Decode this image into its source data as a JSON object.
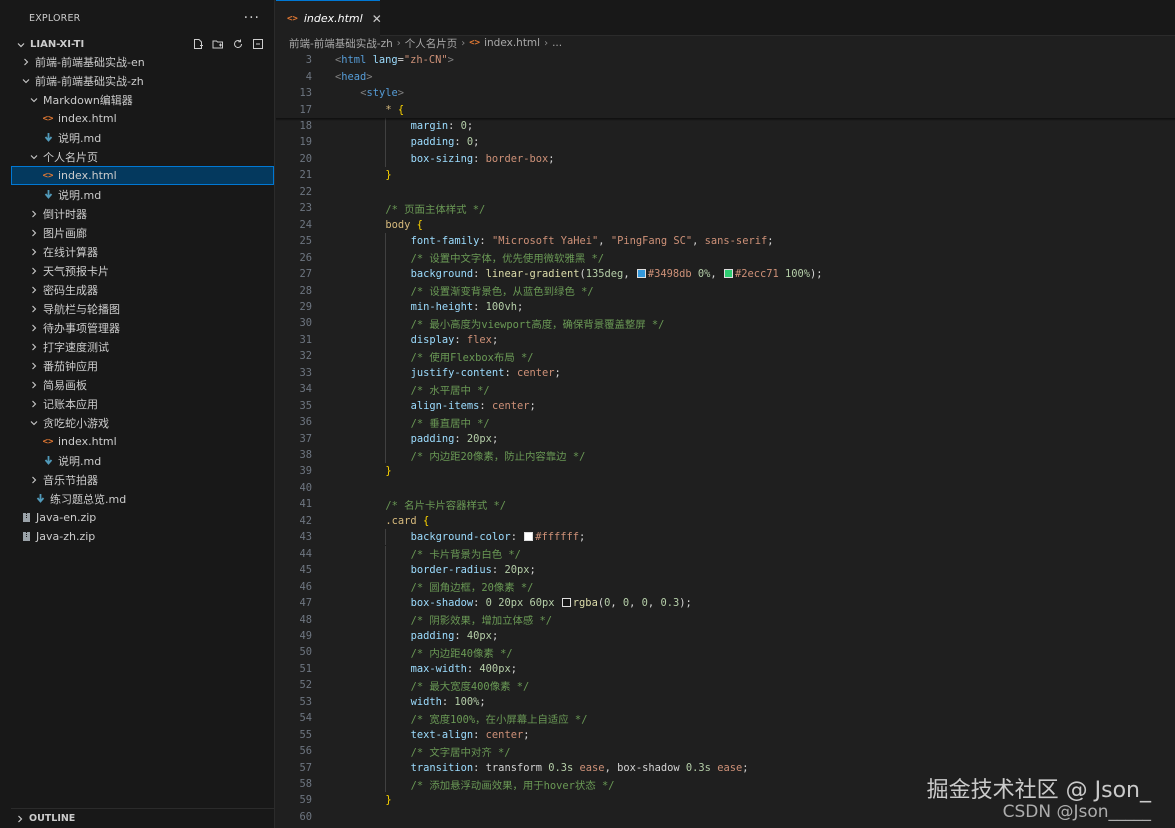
{
  "sidebar": {
    "title": "EXPLORER",
    "more": "···",
    "folder": "LIAN-XI-TI",
    "items": [
      {
        "label": "前端-前端基础实战-en",
        "type": "folder",
        "expanded": false,
        "depth": 1
      },
      {
        "label": "前端-前端基础实战-zh",
        "type": "folder",
        "expanded": true,
        "depth": 1
      },
      {
        "label": "Markdown编辑器",
        "type": "folder",
        "expanded": true,
        "depth": 2
      },
      {
        "label": "index.html",
        "type": "html",
        "depth": 3
      },
      {
        "label": "说明.md",
        "type": "md",
        "depth": 3
      },
      {
        "label": "个人名片页",
        "type": "folder",
        "expanded": true,
        "depth": 2
      },
      {
        "label": "index.html",
        "type": "html",
        "depth": 3,
        "selected": true
      },
      {
        "label": "说明.md",
        "type": "md",
        "depth": 3
      },
      {
        "label": "倒计时器",
        "type": "folder",
        "expanded": false,
        "depth": 2
      },
      {
        "label": "图片画廊",
        "type": "folder",
        "expanded": false,
        "depth": 2
      },
      {
        "label": "在线计算器",
        "type": "folder",
        "expanded": false,
        "depth": 2
      },
      {
        "label": "天气预报卡片",
        "type": "folder",
        "expanded": false,
        "depth": 2
      },
      {
        "label": "密码生成器",
        "type": "folder",
        "expanded": false,
        "depth": 2
      },
      {
        "label": "导航栏与轮播图",
        "type": "folder",
        "expanded": false,
        "depth": 2
      },
      {
        "label": "待办事项管理器",
        "type": "folder",
        "expanded": false,
        "depth": 2
      },
      {
        "label": "打字速度测试",
        "type": "folder",
        "expanded": false,
        "depth": 2
      },
      {
        "label": "番茄钟应用",
        "type": "folder",
        "expanded": false,
        "depth": 2
      },
      {
        "label": "简易画板",
        "type": "folder",
        "expanded": false,
        "depth": 2
      },
      {
        "label": "记账本应用",
        "type": "folder",
        "expanded": false,
        "depth": 2
      },
      {
        "label": "贪吃蛇小游戏",
        "type": "folder",
        "expanded": true,
        "depth": 2
      },
      {
        "label": "index.html",
        "type": "html",
        "depth": 3
      },
      {
        "label": "说明.md",
        "type": "md",
        "depth": 3
      },
      {
        "label": "音乐节拍器",
        "type": "folder",
        "expanded": false,
        "depth": 2
      },
      {
        "label": "练习题总览.md",
        "type": "md",
        "depth": 2
      },
      {
        "label": "Java-en.zip",
        "type": "zip",
        "depth": 1
      },
      {
        "label": "Java-zh.zip",
        "type": "zip",
        "depth": 1
      }
    ],
    "outline": "OUTLINE"
  },
  "editor": {
    "tab_label": "index.html",
    "breadcrumb": [
      "前端-前端基础实战-zh",
      "个人名片页",
      "index.html",
      "..."
    ]
  },
  "code_lines": [
    {
      "n": "3",
      "indent": 0,
      "sticky": true,
      "t": [
        [
          "tk-ang",
          "<"
        ],
        [
          "tk-tag",
          "html"
        ],
        [
          "tk-p",
          " "
        ],
        [
          "tk-attr",
          "lang"
        ],
        [
          "tk-eq",
          "="
        ],
        [
          "tk-str",
          "\"zh-CN\""
        ],
        [
          "tk-ang",
          ">"
        ]
      ]
    },
    {
      "n": "4",
      "indent": 0,
      "sticky": true,
      "t": [
        [
          "tk-ang",
          "<"
        ],
        [
          "tk-tag",
          "head"
        ],
        [
          "tk-ang",
          ">"
        ]
      ]
    },
    {
      "n": "13",
      "indent": 4,
      "sticky": true,
      "t": [
        [
          "tk-ang",
          "<"
        ],
        [
          "tk-tag",
          "style"
        ],
        [
          "tk-ang",
          ">"
        ]
      ]
    },
    {
      "n": "17",
      "indent": 8,
      "sticky": true,
      "t": [
        [
          "tk-sel",
          "* "
        ],
        [
          "tk-brace",
          "{"
        ]
      ]
    },
    {
      "n": "18",
      "indent": 12,
      "t": [
        [
          "tk-prop",
          "margin"
        ],
        [
          "tk-p",
          ": "
        ],
        [
          "tk-num",
          "0"
        ],
        [
          "tk-p",
          ";"
        ]
      ]
    },
    {
      "n": "19",
      "indent": 12,
      "t": [
        [
          "tk-prop",
          "padding"
        ],
        [
          "tk-p",
          ": "
        ],
        [
          "tk-num",
          "0"
        ],
        [
          "tk-p",
          ";"
        ]
      ]
    },
    {
      "n": "20",
      "indent": 12,
      "t": [
        [
          "tk-prop",
          "box-sizing"
        ],
        [
          "tk-p",
          ": "
        ],
        [
          "tk-val",
          "border-box"
        ],
        [
          "tk-p",
          ";"
        ]
      ]
    },
    {
      "n": "21",
      "indent": 8,
      "t": [
        [
          "tk-brace",
          "}"
        ]
      ]
    },
    {
      "n": "22",
      "indent": 0,
      "t": []
    },
    {
      "n": "23",
      "indent": 8,
      "t": [
        [
          "tk-com",
          "/* 页面主体样式 */"
        ]
      ]
    },
    {
      "n": "24",
      "indent": 8,
      "t": [
        [
          "tk-sel",
          "body "
        ],
        [
          "tk-brace",
          "{"
        ]
      ]
    },
    {
      "n": "25",
      "indent": 12,
      "t": [
        [
          "tk-prop",
          "font-family"
        ],
        [
          "tk-p",
          ": "
        ],
        [
          "tk-str",
          "\"Microsoft YaHei\""
        ],
        [
          "tk-p",
          ", "
        ],
        [
          "tk-str",
          "\"PingFang SC\""
        ],
        [
          "tk-p",
          ", "
        ],
        [
          "tk-val",
          "sans-serif"
        ],
        [
          "tk-p",
          ";"
        ]
      ]
    },
    {
      "n": "26",
      "indent": 12,
      "t": [
        [
          "tk-com",
          "/* 设置中文字体，优先使用微软雅黑 */"
        ]
      ]
    },
    {
      "n": "27",
      "indent": 12,
      "t": [
        [
          "tk-prop",
          "background"
        ],
        [
          "tk-p",
          ": "
        ],
        [
          "tk-fn",
          "linear-gradient"
        ],
        [
          "tk-p",
          "("
        ],
        [
          "tk-num",
          "135deg"
        ],
        [
          "tk-p",
          ", "
        ],
        [
          "swatch",
          "#3498db"
        ],
        [
          "tk-val",
          "#3498db"
        ],
        [
          "tk-p",
          " "
        ],
        [
          "tk-num",
          "0%"
        ],
        [
          "tk-p",
          ", "
        ],
        [
          "swatch",
          "#2ecc71"
        ],
        [
          "tk-val",
          "#2ecc71"
        ],
        [
          "tk-p",
          " "
        ],
        [
          "tk-num",
          "100%"
        ],
        [
          "tk-p",
          ");"
        ]
      ]
    },
    {
      "n": "28",
      "indent": 12,
      "t": [
        [
          "tk-com",
          "/* 设置渐变背景色，从蓝色到绿色 */"
        ]
      ]
    },
    {
      "n": "29",
      "indent": 12,
      "t": [
        [
          "tk-prop",
          "min-height"
        ],
        [
          "tk-p",
          ": "
        ],
        [
          "tk-num",
          "100vh"
        ],
        [
          "tk-p",
          ";"
        ]
      ]
    },
    {
      "n": "30",
      "indent": 12,
      "t": [
        [
          "tk-com",
          "/* 最小高度为viewport高度，确保背景覆盖整屏 */"
        ]
      ]
    },
    {
      "n": "31",
      "indent": 12,
      "t": [
        [
          "tk-prop",
          "display"
        ],
        [
          "tk-p",
          ": "
        ],
        [
          "tk-val",
          "flex"
        ],
        [
          "tk-p",
          ";"
        ]
      ]
    },
    {
      "n": "32",
      "indent": 12,
      "t": [
        [
          "tk-com",
          "/* 使用Flexbox布局 */"
        ]
      ]
    },
    {
      "n": "33",
      "indent": 12,
      "t": [
        [
          "tk-prop",
          "justify-content"
        ],
        [
          "tk-p",
          ": "
        ],
        [
          "tk-val",
          "center"
        ],
        [
          "tk-p",
          ";"
        ]
      ]
    },
    {
      "n": "34",
      "indent": 12,
      "t": [
        [
          "tk-com",
          "/* 水平居中 */"
        ]
      ]
    },
    {
      "n": "35",
      "indent": 12,
      "t": [
        [
          "tk-prop",
          "align-items"
        ],
        [
          "tk-p",
          ": "
        ],
        [
          "tk-val",
          "center"
        ],
        [
          "tk-p",
          ";"
        ]
      ]
    },
    {
      "n": "36",
      "indent": 12,
      "t": [
        [
          "tk-com",
          "/* 垂直居中 */"
        ]
      ]
    },
    {
      "n": "37",
      "indent": 12,
      "t": [
        [
          "tk-prop",
          "padding"
        ],
        [
          "tk-p",
          ": "
        ],
        [
          "tk-num",
          "20px"
        ],
        [
          "tk-p",
          ";"
        ]
      ]
    },
    {
      "n": "38",
      "indent": 12,
      "t": [
        [
          "tk-com",
          "/* 内边距20像素，防止内容靠边 */"
        ]
      ]
    },
    {
      "n": "39",
      "indent": 8,
      "t": [
        [
          "tk-brace",
          "}"
        ]
      ]
    },
    {
      "n": "40",
      "indent": 0,
      "t": []
    },
    {
      "n": "41",
      "indent": 8,
      "t": [
        [
          "tk-com",
          "/* 名片卡片容器样式 */"
        ]
      ]
    },
    {
      "n": "42",
      "indent": 8,
      "t": [
        [
          "tk-sel",
          ".card "
        ],
        [
          "tk-brace",
          "{"
        ]
      ]
    },
    {
      "n": "43",
      "indent": 12,
      "t": [
        [
          "tk-prop",
          "background-color"
        ],
        [
          "tk-p",
          ": "
        ],
        [
          "swatch",
          "#ffffff"
        ],
        [
          "tk-val",
          "#ffffff"
        ],
        [
          "tk-p",
          ";"
        ]
      ]
    },
    {
      "n": "44",
      "indent": 12,
      "t": [
        [
          "tk-com",
          "/* 卡片背景为白色 */"
        ]
      ]
    },
    {
      "n": "45",
      "indent": 12,
      "t": [
        [
          "tk-prop",
          "border-radius"
        ],
        [
          "tk-p",
          ": "
        ],
        [
          "tk-num",
          "20px"
        ],
        [
          "tk-p",
          ";"
        ]
      ]
    },
    {
      "n": "46",
      "indent": 12,
      "t": [
        [
          "tk-com",
          "/* 圆角边框，20像素 */"
        ]
      ]
    },
    {
      "n": "47",
      "indent": 12,
      "t": [
        [
          "tk-prop",
          "box-shadow"
        ],
        [
          "tk-p",
          ": "
        ],
        [
          "tk-num",
          "0"
        ],
        [
          "tk-p",
          " "
        ],
        [
          "tk-num",
          "20px"
        ],
        [
          "tk-p",
          " "
        ],
        [
          "tk-num",
          "60px"
        ],
        [
          "tk-p",
          " "
        ],
        [
          "swatch",
          "rgba(0,0,0,0.3)"
        ],
        [
          "tk-fn",
          "rgba"
        ],
        [
          "tk-p",
          "("
        ],
        [
          "tk-num",
          "0"
        ],
        [
          "tk-p",
          ", "
        ],
        [
          "tk-num",
          "0"
        ],
        [
          "tk-p",
          ", "
        ],
        [
          "tk-num",
          "0"
        ],
        [
          "tk-p",
          ", "
        ],
        [
          "tk-num",
          "0.3"
        ],
        [
          "tk-p",
          ");"
        ]
      ]
    },
    {
      "n": "48",
      "indent": 12,
      "t": [
        [
          "tk-com",
          "/* 阴影效果，增加立体感 */"
        ]
      ]
    },
    {
      "n": "49",
      "indent": 12,
      "t": [
        [
          "tk-prop",
          "padding"
        ],
        [
          "tk-p",
          ": "
        ],
        [
          "tk-num",
          "40px"
        ],
        [
          "tk-p",
          ";"
        ]
      ]
    },
    {
      "n": "50",
      "indent": 12,
      "t": [
        [
          "tk-com",
          "/* 内边距40像素 */"
        ]
      ]
    },
    {
      "n": "51",
      "indent": 12,
      "t": [
        [
          "tk-prop",
          "max-width"
        ],
        [
          "tk-p",
          ": "
        ],
        [
          "tk-num",
          "400px"
        ],
        [
          "tk-p",
          ";"
        ]
      ]
    },
    {
      "n": "52",
      "indent": 12,
      "t": [
        [
          "tk-com",
          "/* 最大宽度400像素 */"
        ]
      ]
    },
    {
      "n": "53",
      "indent": 12,
      "t": [
        [
          "tk-prop",
          "width"
        ],
        [
          "tk-p",
          ": "
        ],
        [
          "tk-num",
          "100%"
        ],
        [
          "tk-p",
          ";"
        ]
      ]
    },
    {
      "n": "54",
      "indent": 12,
      "t": [
        [
          "tk-com",
          "/* 宽度100%，在小屏幕上自适应 */"
        ]
      ]
    },
    {
      "n": "55",
      "indent": 12,
      "t": [
        [
          "tk-prop",
          "text-align"
        ],
        [
          "tk-p",
          ": "
        ],
        [
          "tk-val",
          "center"
        ],
        [
          "tk-p",
          ";"
        ]
      ]
    },
    {
      "n": "56",
      "indent": 12,
      "t": [
        [
          "tk-com",
          "/* 文字居中对齐 */"
        ]
      ]
    },
    {
      "n": "57",
      "indent": 12,
      "t": [
        [
          "tk-prop",
          "transition"
        ],
        [
          "tk-p",
          ": "
        ],
        [
          "tk-p",
          "transform "
        ],
        [
          "tk-num",
          "0.3s"
        ],
        [
          "tk-p",
          " "
        ],
        [
          "tk-val",
          "ease"
        ],
        [
          "tk-p",
          ", box-shadow "
        ],
        [
          "tk-num",
          "0.3s"
        ],
        [
          "tk-p",
          " "
        ],
        [
          "tk-val",
          "ease"
        ],
        [
          "tk-p",
          ";"
        ]
      ]
    },
    {
      "n": "58",
      "indent": 12,
      "t": [
        [
          "tk-com",
          "/* 添加悬浮动画效果，用于hover状态 */"
        ]
      ]
    },
    {
      "n": "59",
      "indent": 8,
      "t": [
        [
          "tk-brace",
          "}"
        ]
      ]
    },
    {
      "n": "60",
      "indent": 0,
      "t": []
    }
  ],
  "watermark": {
    "line1": "掘金技术社区 @ Json_",
    "line2": "CSDN @Json_____"
  }
}
